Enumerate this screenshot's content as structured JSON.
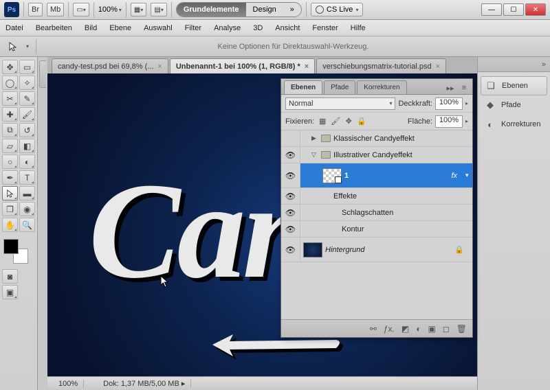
{
  "top": {
    "ps": "Ps",
    "br": "Br",
    "mb": "Mb",
    "zoom": "100%",
    "ws_active": "Grundelemente",
    "ws_inactive": "Design",
    "chevrons": "»",
    "cs_live": "CS Live"
  },
  "menus": [
    "Datei",
    "Bearbeiten",
    "Bild",
    "Ebene",
    "Auswahl",
    "Filter",
    "Analyse",
    "3D",
    "Ansicht",
    "Fenster",
    "Hilfe"
  ],
  "options_text": "Keine Optionen für Direktauswahl-Werkzeug.",
  "doc_tabs": [
    {
      "label": "candy-test.psd bei 69,8% (...",
      "active": false
    },
    {
      "label": "Unbenannt-1 bei 100% (1, RGB/8) *",
      "active": true
    },
    {
      "label": "verschiebungsmatrix-tutorial.psd",
      "active": false
    }
  ],
  "canvas_text": "Can",
  "status": {
    "zoom": "100%",
    "doc": "Dok: 1,37 MB/5,00 MB"
  },
  "right_panels": [
    {
      "label": "Ebenen"
    },
    {
      "label": "Pfade"
    },
    {
      "label": "Korrekturen"
    }
  ],
  "layers_panel": {
    "tabs": [
      "Ebenen",
      "Pfade",
      "Korrekturen"
    ],
    "blend_mode": "Normal",
    "opacity_label": "Deckkraft:",
    "opacity_value": "100%",
    "fill_label": "Fläche:",
    "fill_value": "100%",
    "lock_label": "Fixieren:",
    "group1": "Klassischer Candyeffekt",
    "group2": "Illustrativer Candyeffekt",
    "layer1": "1",
    "fx": "fx",
    "effects": "Effekte",
    "effect1": "Schlagschatten",
    "effect2": "Kontur",
    "background": "Hintergrund"
  }
}
